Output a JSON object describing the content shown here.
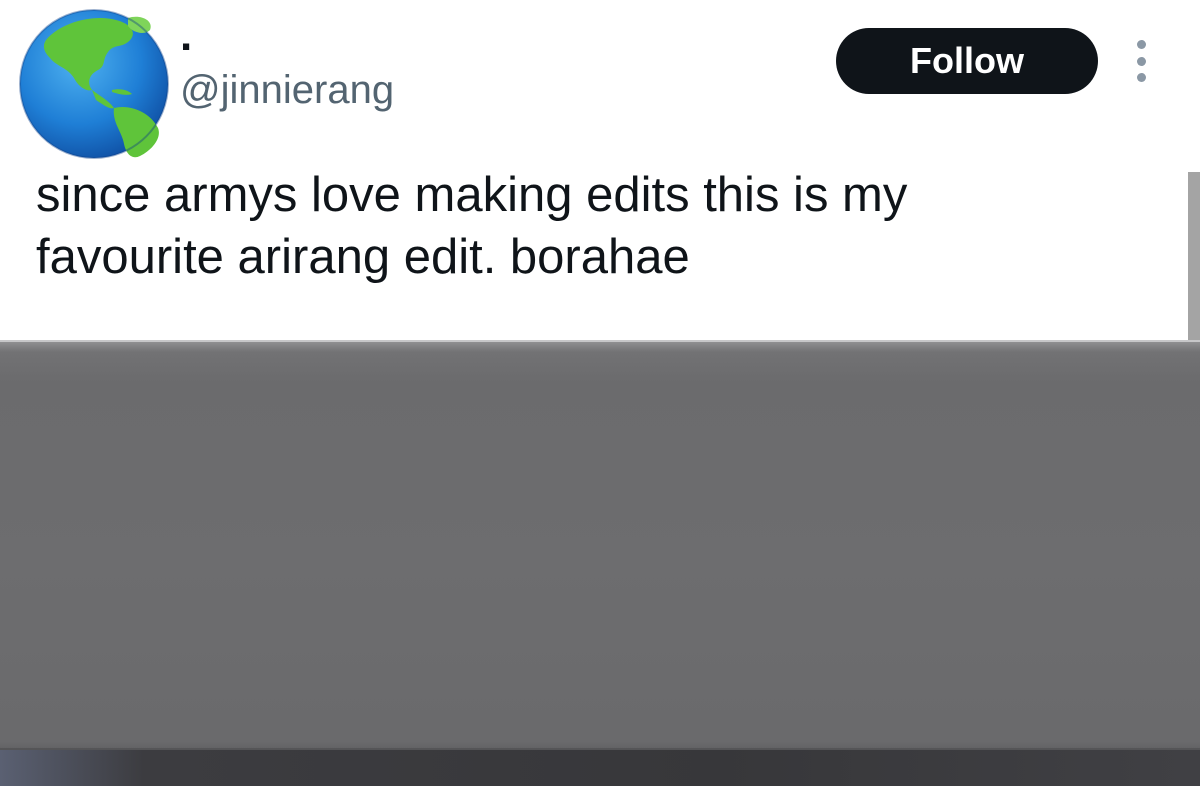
{
  "tweet": {
    "display_name": ".",
    "handle": "@jinnierang",
    "follow_label": "Follow",
    "text_line1": "since armys love making edits this is my",
    "text_line2": "favourite arirang edit. borahae"
  },
  "icons": {
    "avatar": "globe-avatar",
    "more": "more-options-icon"
  },
  "colors": {
    "follow_bg": "#0f1419",
    "handle": "#536471",
    "text": "#0f1419",
    "media": "#6c6c6e"
  }
}
